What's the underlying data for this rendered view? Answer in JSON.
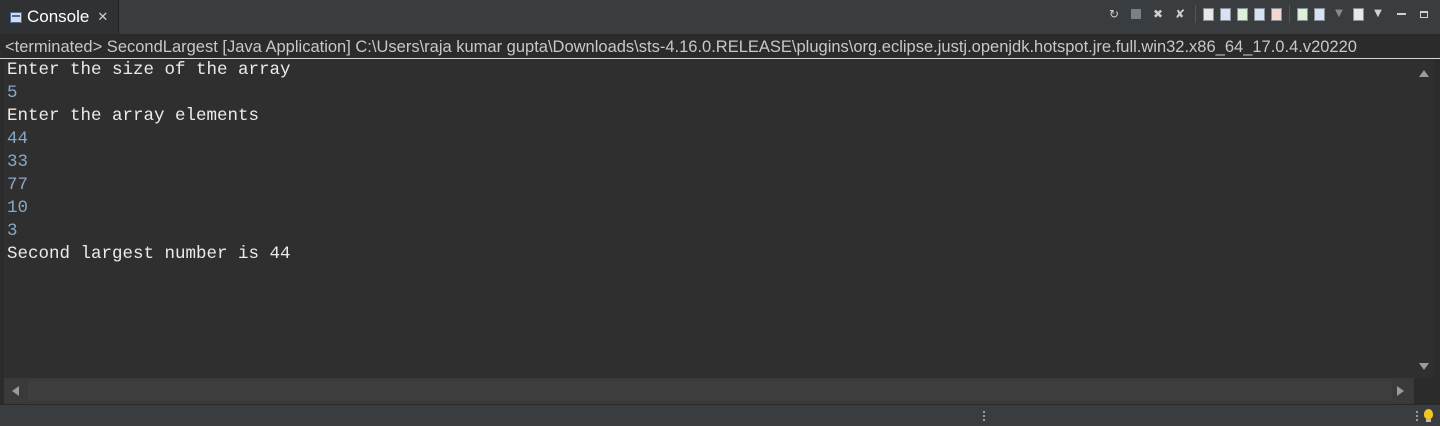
{
  "tab": {
    "title": "Console",
    "close_glyph": "✕"
  },
  "status_line": "<terminated> SecondLargest [Java Application] C:\\Users\\raja kumar gupta\\Downloads\\sts-4.16.0.RELEASE\\plugins\\org.eclipse.justj.openjdk.hotspot.jre.full.win32.x86_64_17.0.4.v20220",
  "console_lines": [
    {
      "text": "Enter the size of the array",
      "kind": "out"
    },
    {
      "text": "5",
      "kind": "in"
    },
    {
      "text": "Enter the array elements",
      "kind": "out"
    },
    {
      "text": "44",
      "kind": "in"
    },
    {
      "text": "33",
      "kind": "in"
    },
    {
      "text": "77",
      "kind": "in"
    },
    {
      "text": "10",
      "kind": "in"
    },
    {
      "text": "3",
      "kind": "in"
    },
    {
      "text": "Second largest number is 44",
      "kind": "out"
    }
  ],
  "toolbar_icons": [
    "relaunch-icon",
    "terminate-icon",
    "remove-launch-icon",
    "remove-all-terminated-icon",
    "clear-console-icon",
    "scroll-lock-icon",
    "word-wrap-icon",
    "show-on-stdout-icon",
    "show-on-stderr-icon",
    "pin-console-icon",
    "display-selected-console-icon",
    "open-console-icon",
    "view-menu-icon",
    "minimize-icon",
    "maximize-icon"
  ],
  "colors": {
    "output_text": "#ebebeb",
    "input_text": "#8aa7c4",
    "background": "#2f2f2f"
  }
}
